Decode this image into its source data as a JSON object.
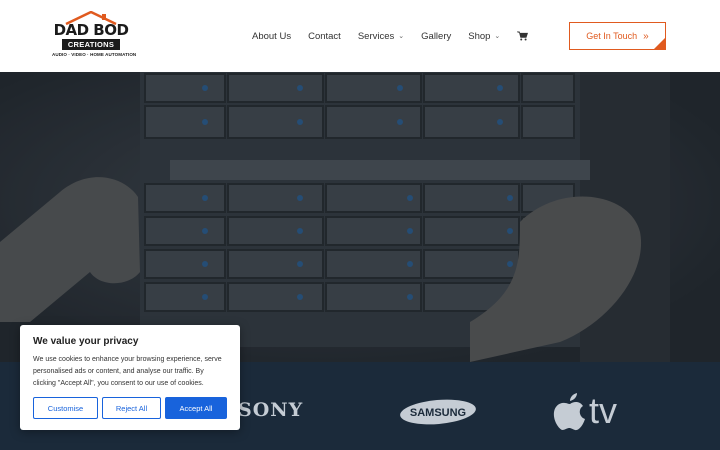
{
  "logo": {
    "main": "DAD BOD",
    "sub": "CREATIONS",
    "tag": "AUDIO · VIDEO · HOME AUTOMATION"
  },
  "nav": {
    "items": [
      {
        "label": "About Us",
        "dropdown": false
      },
      {
        "label": "Contact",
        "dropdown": false
      },
      {
        "label": "Services",
        "dropdown": true
      },
      {
        "label": "Gallery",
        "dropdown": false
      },
      {
        "label": "Shop",
        "dropdown": true
      }
    ],
    "cart_icon": "cart-icon"
  },
  "cta": {
    "label": "Get In Touch",
    "icon": "double-chevron-right-icon"
  },
  "brands": {
    "sony": "SONY",
    "samsung": "SAMSUNG",
    "appletv": "tv"
  },
  "cookie": {
    "title": "We value your privacy",
    "text": "We use cookies to enhance your browsing experience, serve personalised ads or content, and analyse our traffic. By clicking \"Accept All\", you consent to our use of cookies.",
    "customise": "Customise",
    "reject": "Reject All",
    "accept": "Accept All"
  },
  "colors": {
    "accent": "#e05a1f",
    "brand_strip": "#1b2a3a",
    "cookie_blue": "#1863dc"
  }
}
